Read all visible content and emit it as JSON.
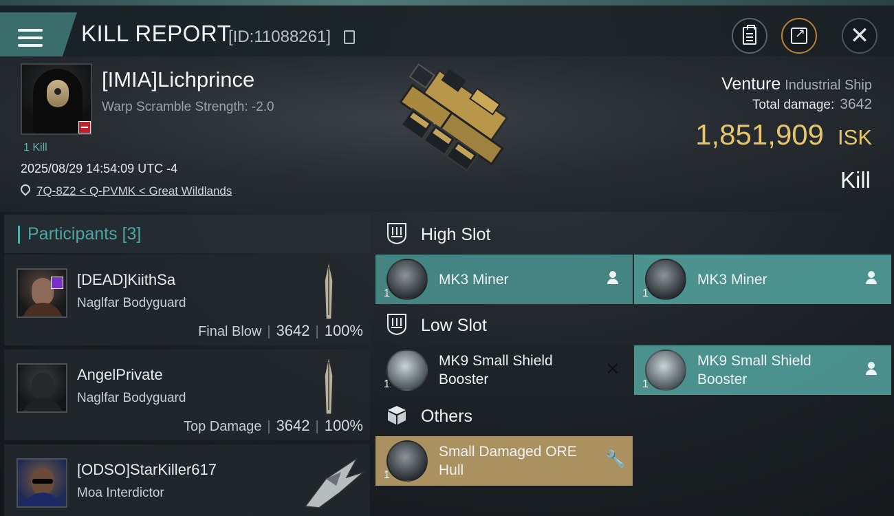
{
  "header": {
    "title": "KILL REPORT",
    "kill_id": "[ID:11088261]",
    "icons": [
      "menu-icon",
      "copy-icon",
      "clipboard-icon",
      "share-icon",
      "close-icon"
    ]
  },
  "victim": {
    "pilot": "[IMIA]Lichprince",
    "warp_scramble": "Warp Scramble Strength: -2.0",
    "kills": "1 Kill",
    "datetime": "2025/08/29 14:54:09 UTC -4",
    "location": "7Q-8Z2 < Q-PVMK < Great Wildlands",
    "ship": "Venture",
    "ship_class": "Industrial Ship",
    "total_damage_label": "Total damage:",
    "total_damage": "3642",
    "isk_value": "1,851,909",
    "isk_unit": "ISK",
    "result": "Kill"
  },
  "participants": {
    "title": "Participants [3]",
    "items": [
      {
        "name": "[DEAD]KiithSa",
        "ship": "Naglfar Bodyguard",
        "role": "Final Blow",
        "damage": "3642",
        "percent": "100%"
      },
      {
        "name": "AngelPrivate",
        "ship": "Naglfar Bodyguard",
        "role": "Top Damage",
        "damage": "3642",
        "percent": "100%"
      },
      {
        "name": "[ODSO]StarKiller617",
        "ship": "Moa Interdictor"
      }
    ]
  },
  "fitting": {
    "high_slot": {
      "title": "High Slot",
      "items": [
        {
          "name": "MK3 Miner",
          "qty": "1",
          "status": "person-icon"
        },
        {
          "name": "MK3 Miner",
          "qty": "1",
          "status": "person-icon"
        }
      ]
    },
    "low_slot": {
      "title": "Low Slot",
      "items": [
        {
          "name_line1": "MK9 Small Shield",
          "name_line2": "Booster",
          "qty": "1",
          "status": "destroyed-x-icon"
        },
        {
          "name_line1": "MK9 Small Shield",
          "name_line2": "Booster",
          "qty": "1",
          "status": "person-icon"
        }
      ]
    },
    "others": {
      "title": "Others",
      "items": [
        {
          "name_line1": "Small Damaged ORE",
          "name_line2": "Hull",
          "qty": "1",
          "status": "wrench-icon"
        }
      ]
    }
  },
  "colors": {
    "teal": "#4a9491",
    "gold": "#e8c56a",
    "panel": "#22282d"
  }
}
